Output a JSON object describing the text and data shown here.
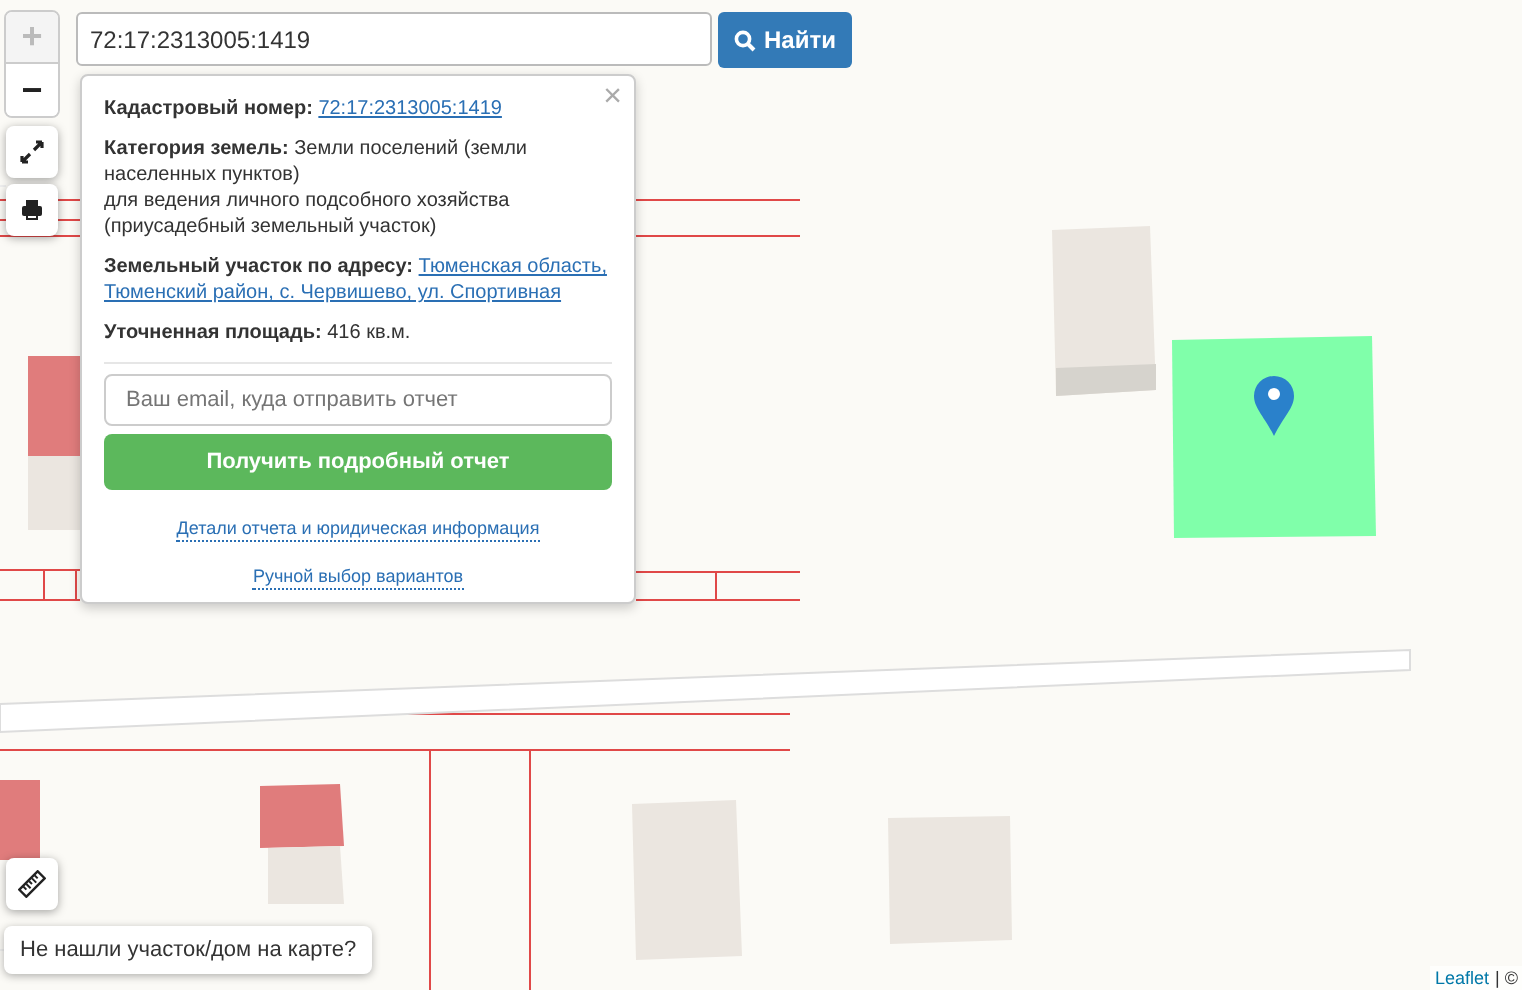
{
  "zoom_controls": [
    {
      "label": "+",
      "disabled": true
    },
    {
      "label": "−",
      "disabled": false
    }
  ],
  "search": {
    "value": "72:17:2313005:1419",
    "button": "Найти"
  },
  "popup": {
    "close": "×",
    "cadastral": {
      "label": "Кадастровый номер:",
      "link": "72:17:2313005:1419"
    },
    "category": {
      "label": "Категория земель:",
      "value": "Земли поселений (земли населенных пунктов)",
      "details": [
        "для ведения личного подсобного хозяйства",
        "(приусадебный земельный участок)"
      ]
    },
    "address": {
      "label": "Земельный участок по адресу:",
      "link_lines": [
        "Тюменская область,",
        "Тюменский район, с. Червишево, ул. Спортивная"
      ]
    },
    "area": {
      "label": "Уточненная площадь:",
      "value": "416 кв.м."
    },
    "email": {
      "placeholder": "Ваш email, куда отправить отчет"
    },
    "report_button": "Получить подробный отчет",
    "links": [
      "Детали отчета и юридическая информация",
      "Ручной выбор вариантов"
    ]
  },
  "not_found_hint": "Не нашли участок/дом на карте?",
  "attribution": {
    "link": "Leaflet",
    "rest": "| ©"
  }
}
